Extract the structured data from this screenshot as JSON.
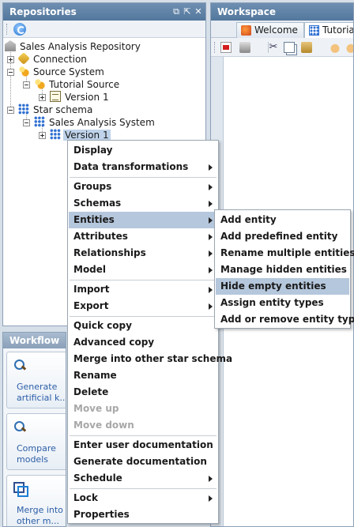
{
  "repositories_panel": {
    "title": "Repositories",
    "controls": [
      "⧉",
      "⇱",
      "✕"
    ],
    "tree": [
      {
        "label": "Sales Analysis Repository"
      },
      {
        "label": "Connection"
      },
      {
        "label": "Source System"
      },
      {
        "label": "Tutorial Source"
      },
      {
        "label": "Version 1"
      },
      {
        "label": "Star schema"
      },
      {
        "label": "Sales Analysis System"
      },
      {
        "label": "Version 1"
      }
    ]
  },
  "workflow_panel": {
    "title": "Workflow",
    "items": [
      {
        "line1": "Generate",
        "line2": "artificial k..."
      },
      {
        "line1": "Compare",
        "line2": "models"
      },
      {
        "line1": "Merge into",
        "line2": "other m..."
      }
    ]
  },
  "workspace": {
    "title": "Workspace",
    "tabs": [
      {
        "label": "Welcome"
      },
      {
        "label": "Tutorial"
      }
    ]
  },
  "context_menu": {
    "items": [
      {
        "label": "Display"
      },
      {
        "label": "Data transformations"
      },
      {
        "label": "Groups"
      },
      {
        "label": "Schemas"
      },
      {
        "label": "Entities"
      },
      {
        "label": "Attributes"
      },
      {
        "label": "Relationships"
      },
      {
        "label": "Model"
      },
      {
        "label": "Import"
      },
      {
        "label": "Export"
      },
      {
        "label": "Quick copy"
      },
      {
        "label": "Advanced copy"
      },
      {
        "label": "Merge into other star schema"
      },
      {
        "label": "Rename"
      },
      {
        "label": "Delete"
      },
      {
        "label": "Move up"
      },
      {
        "label": "Move down"
      },
      {
        "label": "Enter user documentation"
      },
      {
        "label": "Generate documentation"
      },
      {
        "label": "Schedule"
      },
      {
        "label": "Lock"
      },
      {
        "label": "Properties"
      }
    ]
  },
  "entities_submenu": {
    "items": [
      {
        "label": "Add entity"
      },
      {
        "label": "Add predefined entity"
      },
      {
        "label": "Rename multiple entities"
      },
      {
        "label": "Manage hidden entities"
      },
      {
        "label": "Hide empty entities"
      },
      {
        "label": "Assign entity types"
      },
      {
        "label": "Add or remove entity types"
      }
    ]
  }
}
